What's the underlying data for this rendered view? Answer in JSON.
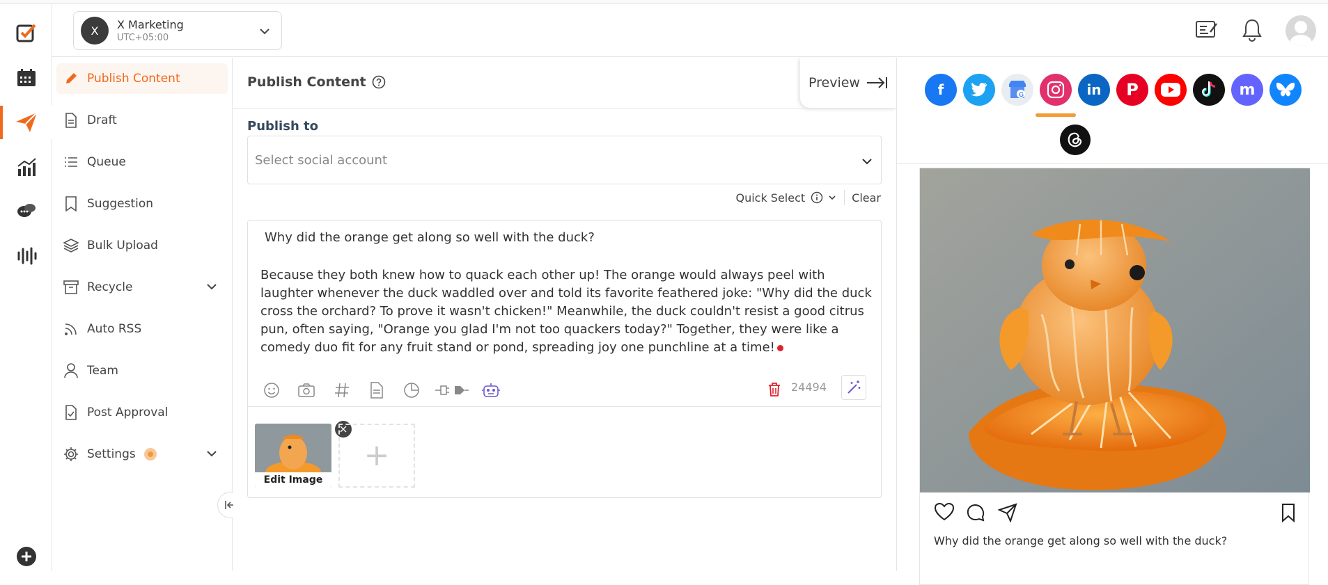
{
  "workspace": {
    "initial": "X",
    "name": "X Marketing",
    "timezone": "UTC+05:00"
  },
  "sidebar": {
    "items": [
      {
        "label": "Publish Content",
        "icon": "pencil-icon"
      },
      {
        "label": "Draft",
        "icon": "document-icon"
      },
      {
        "label": "Queue",
        "icon": "list-icon"
      },
      {
        "label": "Suggestion",
        "icon": "bookmark-icon"
      },
      {
        "label": "Bulk Upload",
        "icon": "layers-icon"
      },
      {
        "label": "Recycle",
        "icon": "archive-icon"
      },
      {
        "label": "Auto RSS",
        "icon": "rss-icon"
      },
      {
        "label": "Team",
        "icon": "person-icon"
      },
      {
        "label": "Post Approval",
        "icon": "file-check-icon"
      },
      {
        "label": "Settings",
        "icon": "gear-icon"
      }
    ]
  },
  "main": {
    "title": "Publish Content",
    "preview_label": "Preview",
    "publish_to_label": "Publish to",
    "account_placeholder": "Select social account",
    "quick_select_label": "Quick Select",
    "clear_label": "Clear",
    "post_question": "Why did the orange get along so well with the duck?",
    "post_body": "Because they both knew how to quack each other up! The orange would always peel with laughter whenever the duck waddled over and told its favorite feathered joke: \"Why did the duck cross the orchard? To prove it wasn't chicken!\" Meanwhile, the duck couldn't resist a good citrus pun, often saying, \"Orange you glad I'm not too quackers today?\" Together, they were like a comedy duo fit for any fruit stand or pond, spreading joy one punchline at a time!",
    "char_count": "24494",
    "media": {
      "edit_label": "Edit Image",
      "remove_symbol": "×",
      "add_symbol": "+"
    }
  },
  "preview": {
    "networks": [
      "Facebook",
      "Twitter",
      "Google Business",
      "Instagram",
      "LinkedIn",
      "Pinterest",
      "YouTube",
      "TikTok",
      "Mastodon",
      "Bluesky",
      "Threads"
    ],
    "selected_network": "Instagram",
    "caption": "Why did the orange get along so well with the duck?"
  },
  "colors": {
    "accent": "#f06a1e",
    "facebook": "#1877f2",
    "twitter": "#1da1f2",
    "instagram": "#e1306c",
    "linkedin": "#0a66c2",
    "pinterest": "#e60023",
    "youtube": "#ff0000",
    "mastodon": "#6364ff",
    "bluesky": "#1185fe"
  }
}
